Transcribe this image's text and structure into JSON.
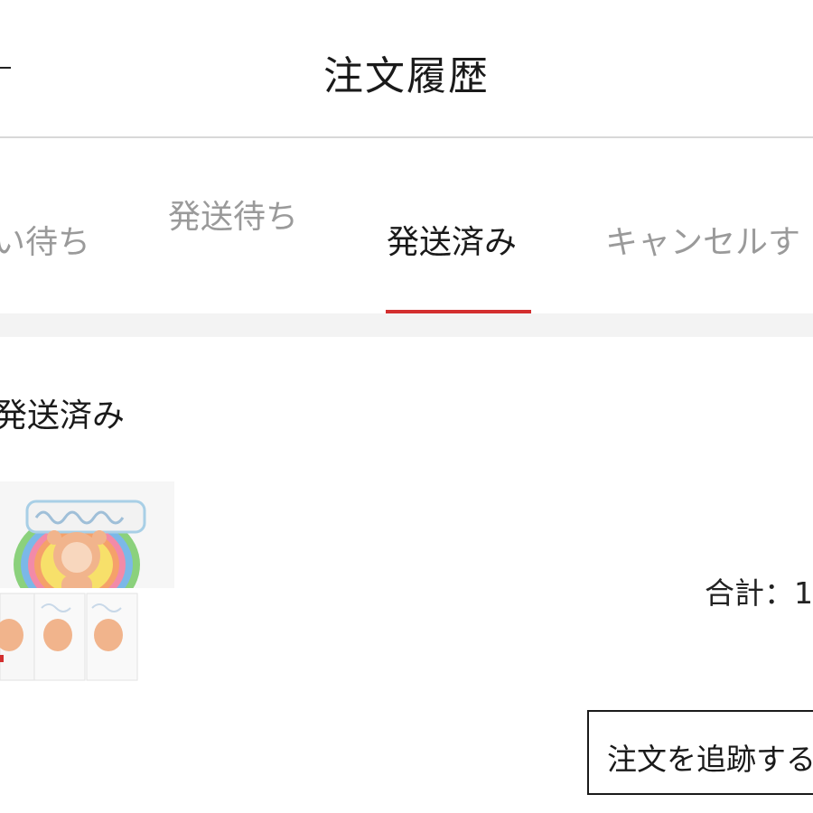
{
  "header": {
    "title": "注文履歴",
    "back_icon": "back-arrow-icon"
  },
  "tabs": [
    {
      "label": "い待ち",
      "active": false
    },
    {
      "label": "発送待ち",
      "active": false
    },
    {
      "label": "発送済み",
      "active": true
    },
    {
      "label": "キャンセルす",
      "active": false
    }
  ],
  "colors": {
    "accent": "#d32f2f",
    "text": "#1a1a1a",
    "inactive_text": "#9a9a9a",
    "divider": "#d8d8d8",
    "band": "#f3f3f3"
  },
  "order": {
    "status": "発送済み",
    "product_image": "product-box-image",
    "total": "合計：1",
    "track_button": "注文を追跡する"
  }
}
